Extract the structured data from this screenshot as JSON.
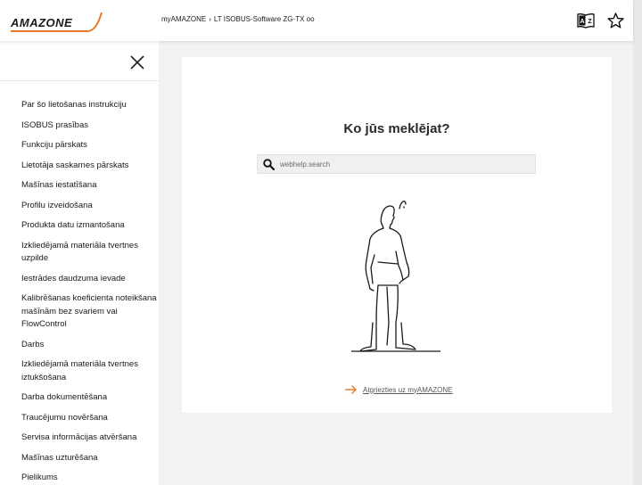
{
  "header": {
    "logo_text": "AMAZONE",
    "breadcrumb": [
      "myAMAZONE",
      "LT ISOBUS-Software ZG-TX oo"
    ],
    "breadcrumb_sep": "›",
    "icons": [
      "translate-icon",
      "star-icon"
    ]
  },
  "sidebar": {
    "close_icon": "close-icon",
    "items": [
      "Par šo lietošanas instrukciju",
      "ISOBUS prasības",
      "Funkciju pārskats",
      "Lietotāja saskarnes pārskats",
      "Mašīnas iestatīšana",
      "Profilu izveidošana",
      "Produkta datu izmantošana",
      "Izkliedējamā materiāla tvertnes uzpilde",
      "Iestrādes daudzuma ievade",
      "Kalibrēšanas koeficienta noteikšana mašīnām bez svariem vai FlowControl",
      "Darbs",
      "Izkliedējamā materiāla tvertnes iztukšošana",
      "Darba dokumentēšana",
      "Traucējumu novēršana",
      "Servisa informācijas atvēršana",
      "Mašīnas uzturēšana",
      "Pielikums"
    ]
  },
  "main": {
    "title": "Ko jūs meklējat?",
    "search": {
      "placeholder": "webhelp.search",
      "value": ""
    },
    "back_link": "Atgriezties uz myAMAZONE"
  },
  "colors": {
    "accent": "#e8792b",
    "card": "#ffffff",
    "page_bg": "#f2f2f2"
  }
}
